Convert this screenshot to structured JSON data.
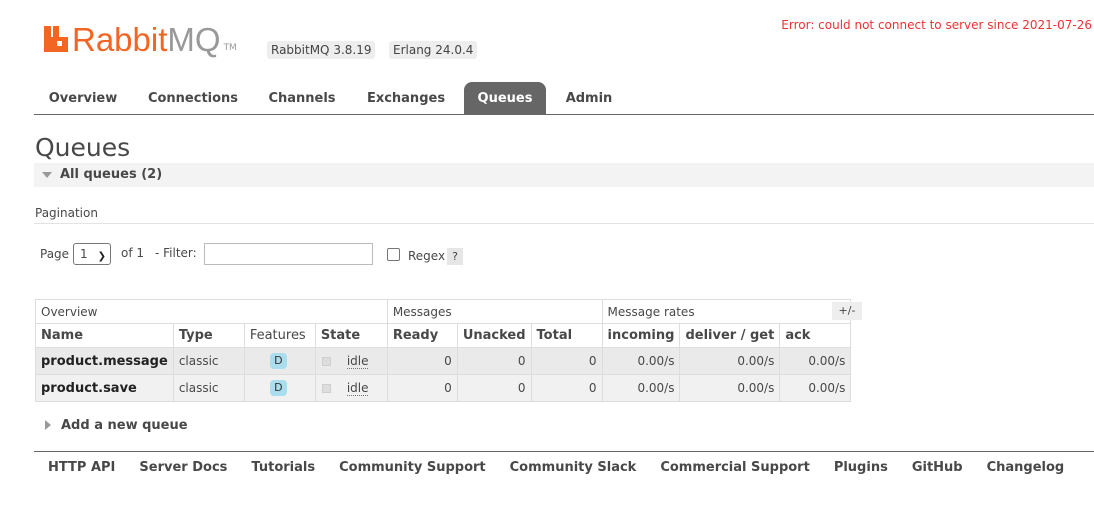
{
  "header": {
    "logo_rabbit": "Rabbit",
    "logo_mq": "MQ",
    "logo_tm": "TM",
    "version_rabbitmq": "RabbitMQ 3.8.19",
    "version_erlang": "Erlang 24.0.4",
    "error": "Error: could not connect to server since 2021-07-26"
  },
  "tabs": [
    {
      "label": "Overview"
    },
    {
      "label": "Connections"
    },
    {
      "label": "Channels"
    },
    {
      "label": "Exchanges"
    },
    {
      "label": "Queues",
      "active": true
    },
    {
      "label": "Admin"
    }
  ],
  "page": {
    "title": "Queues",
    "section": "All queues (2)",
    "pagination_title": "Pagination",
    "page_label": "Page",
    "page_value": "1",
    "of_label": "of 1",
    "filter_label": "- Filter:",
    "filter_value": "",
    "regex_label": "Regex",
    "regex_checked": false,
    "help": "?",
    "plus_minus": "+/-",
    "add_queue": "Add a new queue"
  },
  "table": {
    "groups": [
      "Overview",
      "Messages",
      "Message rates"
    ],
    "columns": [
      "Name",
      "Type",
      "Features",
      "State",
      "Ready",
      "Unacked",
      "Total",
      "incoming",
      "deliver / get",
      "ack"
    ],
    "rows": [
      {
        "name": "product.message",
        "type": "classic",
        "feature": "D",
        "state": "idle",
        "ready": "0",
        "unacked": "0",
        "total": "0",
        "incoming": "0.00/s",
        "deliver": "0.00/s",
        "ack": "0.00/s"
      },
      {
        "name": "product.save",
        "type": "classic",
        "feature": "D",
        "state": "idle",
        "ready": "0",
        "unacked": "0",
        "total": "0",
        "incoming": "0.00/s",
        "deliver": "0.00/s",
        "ack": "0.00/s"
      }
    ]
  },
  "footer": [
    "HTTP API",
    "Server Docs",
    "Tutorials",
    "Community Support",
    "Community Slack",
    "Commercial Support",
    "Plugins",
    "GitHub",
    "Changelog"
  ],
  "colors": {
    "brand": "#f26522",
    "error": "#ee3333",
    "active_tab": "#666666",
    "feature_badge": "#aaddee"
  }
}
